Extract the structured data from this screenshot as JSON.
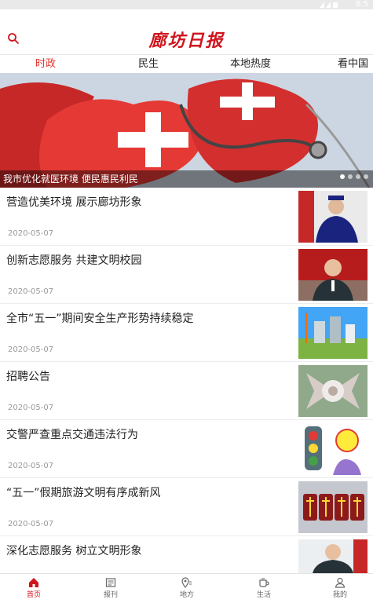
{
  "status_bar": {
    "time": "8:5"
  },
  "header": {
    "logo_text": "廊坊日报"
  },
  "tabs": [
    {
      "label": "时政",
      "active": true
    },
    {
      "label": "民生",
      "active": false
    },
    {
      "label": "本地热度",
      "active": false
    },
    {
      "label": "看中国",
      "active": false
    }
  ],
  "banner": {
    "caption": "我市优化就医环境 便民惠民利民",
    "dot_count": 4,
    "active_dot": 0
  },
  "news": [
    {
      "title": "营造优美环境 展示廊坊形象",
      "date": "2020-05-07",
      "thumb": "railway-officer"
    },
    {
      "title": "创新志愿服务 共建文明校园",
      "date": "2020-05-07",
      "thumb": "man-portrait"
    },
    {
      "title": "全市“五一”期间安全生产形势持续稳定",
      "date": "2020-05-07",
      "thumb": "construction-site"
    },
    {
      "title": "招聘公告",
      "date": "2020-05-07",
      "thumb": "airport-aerial"
    },
    {
      "title": "交警严查重点交通违法行为",
      "date": "2020-05-07",
      "thumb": "traffic-light-cartoon"
    },
    {
      "title": "“五一”假期旅游文明有序成新风",
      "date": "2020-05-07",
      "thumb": "festival-characters"
    },
    {
      "title": "深化志愿服务 树立文明形象",
      "date": "",
      "thumb": "man-portrait-2"
    }
  ],
  "bottom_nav": [
    {
      "label": "首页",
      "icon": "home-icon",
      "active": true
    },
    {
      "label": "报刊",
      "icon": "newspaper-icon",
      "active": false
    },
    {
      "label": "地方",
      "icon": "location-icon",
      "active": false
    },
    {
      "label": "生活",
      "icon": "coffee-cup-icon",
      "active": false
    },
    {
      "label": "我的",
      "icon": "user-icon",
      "active": false
    }
  ],
  "colors": {
    "accent": "#d0151e",
    "tab_active": "#e0322c"
  }
}
